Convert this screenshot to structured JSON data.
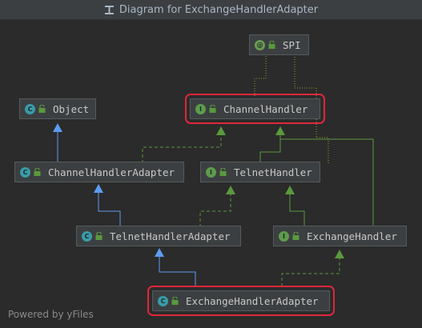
{
  "window": {
    "title": "Diagram for ExchangeHandlerAdapter"
  },
  "nodes": {
    "spi": {
      "label": "SPI",
      "kind": "annotation",
      "kind_letter": "@",
      "highlighted": false
    },
    "object": {
      "label": "Object",
      "kind": "class",
      "kind_letter": "C",
      "highlighted": false
    },
    "channel_handler": {
      "label": "ChannelHandler",
      "kind": "interface",
      "kind_letter": "I",
      "highlighted": true
    },
    "channel_handler_adapter": {
      "label": "ChannelHandlerAdapter",
      "kind": "class",
      "kind_letter": "C",
      "highlighted": false
    },
    "telnet_handler": {
      "label": "TelnetHandler",
      "kind": "interface",
      "kind_letter": "I",
      "highlighted": false
    },
    "telnet_handler_adapter": {
      "label": "TelnetHandlerAdapter",
      "kind": "class",
      "kind_letter": "C",
      "highlighted": false
    },
    "exchange_handler": {
      "label": "ExchangeHandler",
      "kind": "interface",
      "kind_letter": "I",
      "highlighted": false
    },
    "exchange_handler_adapter": {
      "label": "ExchangeHandlerAdapter",
      "kind": "class",
      "kind_letter": "C",
      "highlighted": true
    }
  },
  "edges": [
    {
      "from": "channel_handler_adapter",
      "to": "object",
      "type": "extends"
    },
    {
      "from": "channel_handler_adapter",
      "to": "channel_handler",
      "type": "implements"
    },
    {
      "from": "telnet_handler",
      "to": "channel_handler",
      "type": "extends-interface"
    },
    {
      "from": "exchange_handler",
      "to": "channel_handler",
      "type": "extends-interface"
    },
    {
      "from": "telnet_handler_adapter",
      "to": "channel_handler_adapter",
      "type": "extends"
    },
    {
      "from": "telnet_handler_adapter",
      "to": "telnet_handler",
      "type": "implements"
    },
    {
      "from": "exchange_handler",
      "to": "telnet_handler",
      "type": "extends-interface"
    },
    {
      "from": "exchange_handler_adapter",
      "to": "telnet_handler_adapter",
      "type": "extends"
    },
    {
      "from": "exchange_handler_adapter",
      "to": "exchange_handler",
      "type": "implements"
    },
    {
      "from": "channel_handler",
      "to": "spi",
      "type": "annotated"
    },
    {
      "from": "telnet_handler",
      "to": "spi",
      "type": "annotated"
    }
  ],
  "colors": {
    "extends": "#5d9bf0",
    "implements": "#5a9a3e",
    "annotated": "#9a9a3a",
    "highlight": "#e0263a"
  },
  "footer": {
    "text": "Powered by yFiles"
  }
}
